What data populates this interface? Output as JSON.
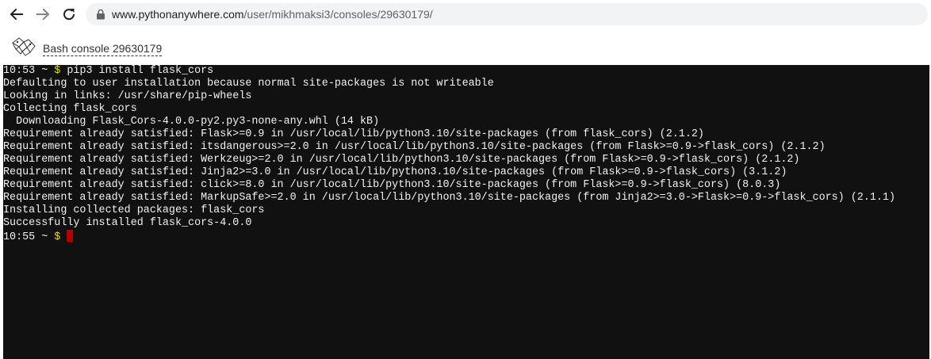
{
  "browser": {
    "url_host": "www.pythonanywhere.com",
    "url_path": "/user/mikhmaksi3/consoles/29630179/"
  },
  "header": {
    "console_title": "Bash console 29630179"
  },
  "terminal": {
    "prompt_1_prefix": "10:53 ~ ",
    "prompt_1_dollar": "$",
    "prompt_1_command": " pip3 install flask_cors",
    "lines": [
      "Defaulting to user installation because normal site-packages is not writeable",
      "Looking in links: /usr/share/pip-wheels",
      "Collecting flask_cors",
      "  Downloading Flask_Cors-4.0.0-py2.py3-none-any.whl (14 kB)",
      "Requirement already satisfied: Flask>=0.9 in /usr/local/lib/python3.10/site-packages (from flask_cors) (2.1.2)",
      "Requirement already satisfied: itsdangerous>=2.0 in /usr/local/lib/python3.10/site-packages (from Flask>=0.9->flask_cors) (2.1.2)",
      "Requirement already satisfied: Werkzeug>=2.0 in /usr/local/lib/python3.10/site-packages (from Flask>=0.9->flask_cors) (2.1.2)",
      "Requirement already satisfied: Jinja2>=3.0 in /usr/local/lib/python3.10/site-packages (from Flask>=0.9->flask_cors) (3.1.2)",
      "Requirement already satisfied: click>=8.0 in /usr/local/lib/python3.10/site-packages (from Flask>=0.9->flask_cors) (8.0.3)",
      "Requirement already satisfied: MarkupSafe>=2.0 in /usr/local/lib/python3.10/site-packages (from Jinja2>=3.0->Flask>=0.9->flask_cors) (2.1.1)",
      "Installing collected packages: flask_cors",
      "Successfully installed flask_cors-4.0.0"
    ],
    "prompt_2_prefix": "10:55 ~ ",
    "prompt_2_dollar": "$",
    "prompt_2_command": " "
  },
  "icons": {
    "back": "arrow-left-icon",
    "forward": "arrow-right-icon",
    "reload": "reload-icon",
    "lock": "lock-icon",
    "logo": "pythonanywhere-logo-icon"
  },
  "colors": {
    "terminal_bg": "#111111",
    "terminal_text": "#f2f2f2",
    "prompt_dollar": "#e5d61a",
    "cursor": "#b00000"
  }
}
